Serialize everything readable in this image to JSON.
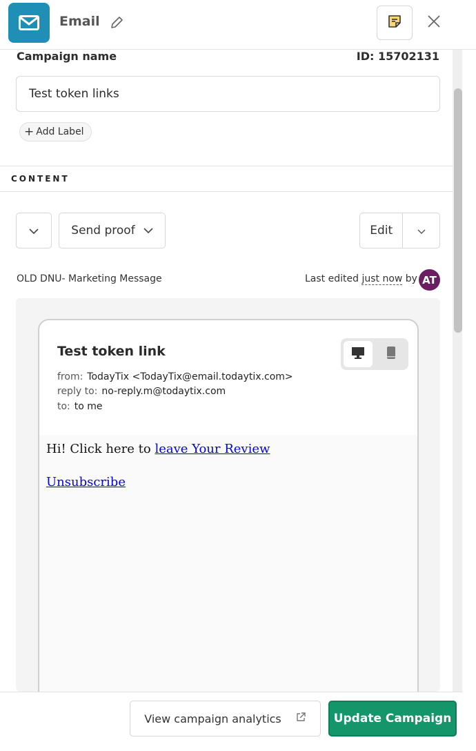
{
  "header": {
    "channel_icon": "envelope-icon",
    "title": "Email",
    "edit_icon": "pencil-icon",
    "notes_icon": "sticky-note-icon",
    "close_icon": "close-icon",
    "accent_color": "#1f8fb5"
  },
  "campaign": {
    "name_label": "Campaign name",
    "id_text": "ID: 15702131",
    "name_value": "Test token links",
    "add_label": "Add Label"
  },
  "content": {
    "section_title": "CONTENT",
    "send_proof_label": "Send proof",
    "edit_label": "Edit",
    "template_name": "OLD DNU- Marketing Message",
    "last_edited_prefix": "Last edited",
    "last_edited_when": "just now",
    "last_edited_by": "by",
    "avatar_initials": "AT",
    "avatar_color": "#6b1f63"
  },
  "preview": {
    "subject": "Test token link",
    "from_label": "from:",
    "from_value": "TodayTix <TodayTix@email.todaytix.com>",
    "reply_label": "reply to:",
    "reply_value": "no-reply.m@todaytix.com",
    "to_label": "to:",
    "to_value": "to me",
    "desktop_icon": "desktop-icon",
    "mobile_icon": "mobile-icon",
    "selected_device": "desktop",
    "body_text": "Hi! Click here to",
    "review_link": "leave Your Review",
    "unsubscribe_link": "Unsubscribe"
  },
  "footer": {
    "analytics_label": "View campaign analytics",
    "external_icon": "external-link-icon",
    "update_label": "Update Campaign",
    "update_color": "#15956a"
  }
}
